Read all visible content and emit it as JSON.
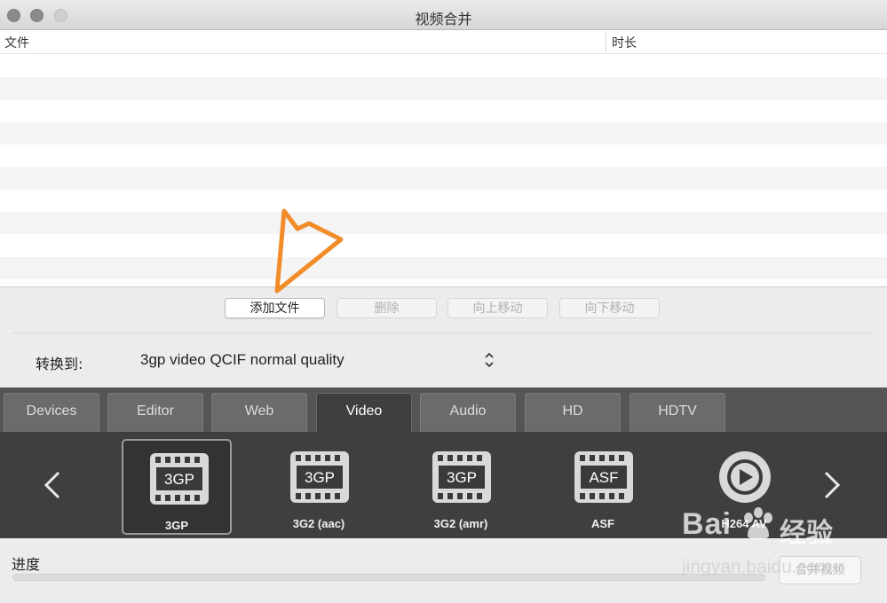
{
  "window": {
    "title": "视频合并"
  },
  "table": {
    "columns": [
      "文件",
      "时长"
    ],
    "rows": []
  },
  "buttons": {
    "add": "添加文件",
    "delete": "删除",
    "move_up": "向上移动",
    "move_down": "向下移动"
  },
  "convert": {
    "label": "转换到:",
    "value": "3gp video QCIF normal quality"
  },
  "tabs": [
    "Devices",
    "Editor",
    "Web",
    "Video",
    "Audio",
    "HD",
    "HDTV"
  ],
  "active_tab": "Video",
  "formats": [
    {
      "label": "3GP",
      "icon_text": "3GP",
      "icon": "film-icon",
      "selected": true
    },
    {
      "label": "3G2 (aac)",
      "icon_text": "3GP",
      "icon": "film-icon",
      "selected": false
    },
    {
      "label": "3G2 (amr)",
      "icon_text": "3GP",
      "icon": "film-icon",
      "selected": false
    },
    {
      "label": "ASF",
      "icon_text": "ASF",
      "icon": "film-icon",
      "selected": false
    },
    {
      "label": "H264 AV",
      "icon_text": "",
      "icon": "play-circle-icon",
      "selected": false
    }
  ],
  "progress": {
    "label": "进度",
    "value": 0
  },
  "merge_button": "合并视频",
  "watermark": {
    "brand": "Bai",
    "brand_cn": "经验",
    "url": "jingyan.baidu.com"
  },
  "colors": {
    "annotation": "#f28c28",
    "progress": "#4a90e2"
  }
}
